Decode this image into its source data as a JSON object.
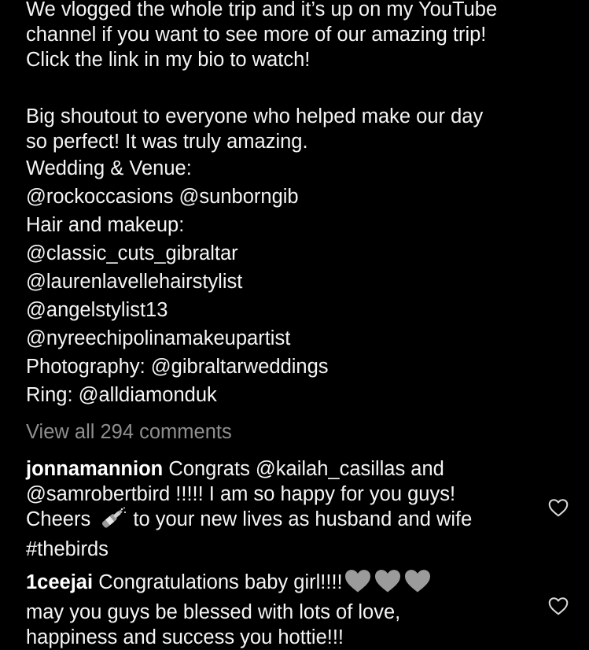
{
  "caption": {
    "lines": [
      "We vlogged the whole trip and it’s up on my YouTube",
      "channel if you want to see more of our amazing trip!",
      "Click the link in my bio to watch!",
      "",
      "Big shoutout to everyone who helped make our day",
      "so perfect! It was truly amazing.",
      "Wedding & Venue:",
      "@rockoccasions @sunborngib",
      "Hair and makeup:",
      "@classic_cuts_gibraltar",
      "@laurenlavellehairstylist",
      "@angelstylist13",
      "@nyreechipolinamakeupartist",
      "Photography: @gibraltarweddings",
      "Ring: @alldiamonduk"
    ]
  },
  "view_all_comments": "View all 294 comments",
  "comments": [
    {
      "username": "jonnamannion",
      "line1": "Congrats @kailah_casillas and",
      "line2": "@samrobertbird !!!!! I am so happy for you guys!",
      "line3_before_emoji": "Cheers",
      "line3_emoji": "champagne-bottle-emoji",
      "line3_after_emoji": "to your new lives as husband and wife",
      "line4": "#thebirds"
    },
    {
      "username": "1ceejai",
      "line1": "Congratulations baby girl!!!!",
      "line1_emojis": [
        "grey-heart-emoji",
        "grey-heart-emoji",
        "grey-heart-emoji"
      ],
      "line2": "may you guys be blessed with lots of love,",
      "line3": "happiness and success you hottie!!!"
    }
  ],
  "icons": {
    "like": "heart-outline-icon"
  },
  "colors": {
    "background": "#000000",
    "text": "#f5f5f5",
    "secondary_text": "#8e8e8e"
  }
}
